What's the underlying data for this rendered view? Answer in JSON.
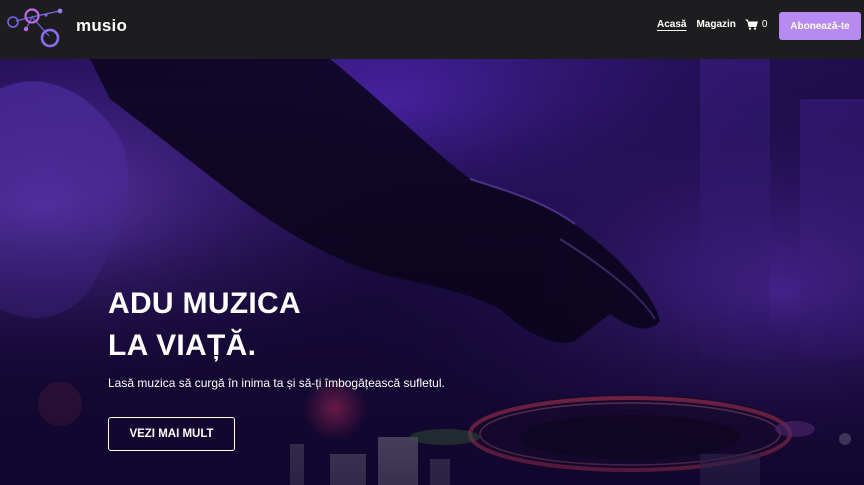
{
  "header": {
    "brand": "musio",
    "nav": [
      {
        "label": "Acasă",
        "active": true
      },
      {
        "label": "Magazin",
        "active": false
      }
    ],
    "cart": {
      "icon": "cart-icon",
      "count": "0"
    },
    "subscribe_label": "Abonează-te"
  },
  "hero": {
    "title_line1": "ADU MUZICA",
    "title_line2": "LA VIAȚĂ.",
    "subtitle": "Lasă muzica să curgă în inima ta și să-ți îmbogățească sufletul.",
    "cta_label": "VEZI MAI MULT"
  },
  "colors": {
    "header_bg": "#1d1d1f",
    "accent": "#b68af0",
    "hero_tint": "#5b2bd8"
  }
}
